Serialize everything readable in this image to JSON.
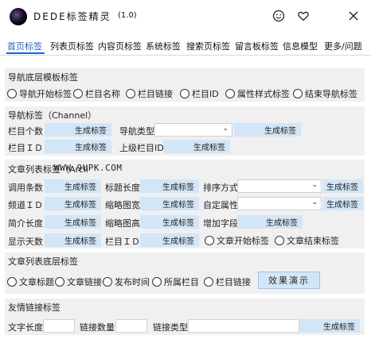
{
  "titlebar": {
    "title": "DEDE标签精灵",
    "version": "(1.0)",
    "smile_icon": "smiley-icon",
    "heart_icon": "heart-icon"
  },
  "tabs": [
    "首页标签",
    "列表页标签",
    "内容页标签",
    "系统标签",
    "搜索页标签",
    "留言板标签",
    "信息模型",
    "更多/问题"
  ],
  "active_tab": 0,
  "generate_label": "生成标签",
  "sections": {
    "nav_base": {
      "title": "导航底层模板标签",
      "radios": [
        "导航开始标签",
        "栏目名称",
        "栏目链接",
        "栏目ID",
        "属性样式标签",
        "结束导航标签"
      ]
    },
    "channel": {
      "title": "导航标签（Channel）",
      "labels": {
        "count": "栏目个数",
        "nav_type": "导航类型",
        "col_id": "栏目ＩＤ",
        "parent_id": "上级栏目ID"
      }
    },
    "arclist": {
      "title": "文章列表标签（Arcli",
      "labels": {
        "num": "调用条数",
        "title_len": "标题长度",
        "order": "排序方式",
        "channel_id": "频道ＩＤ",
        "thumb_w": "缩略图宽",
        "custom_attr": "自定属性",
        "intro_len": "简介长度",
        "thumb_h": "缩略图高",
        "add_field": "增加字段",
        "days": "显示天数",
        "col_id": "栏目ＩＤ"
      },
      "radios": [
        "文章开始标签",
        "文章结束标签"
      ]
    },
    "arc_base": {
      "title": "文章列表底层标签",
      "radios": [
        "文章标题",
        "文章链接",
        "发布时间",
        "所属栏目",
        "栏目链接"
      ],
      "demo_button": "效果演示"
    },
    "flink": {
      "title": "友情链接标签",
      "labels": {
        "text_len": "文字长度",
        "link_count": "链接数量",
        "link_type": "链接类型"
      }
    }
  },
  "watermark": "WWW.9UPK.COM",
  "colors": {
    "accent": "#1e63c7",
    "gen_button": "#d2e6f7",
    "section_bg": "#f0f0f0"
  }
}
